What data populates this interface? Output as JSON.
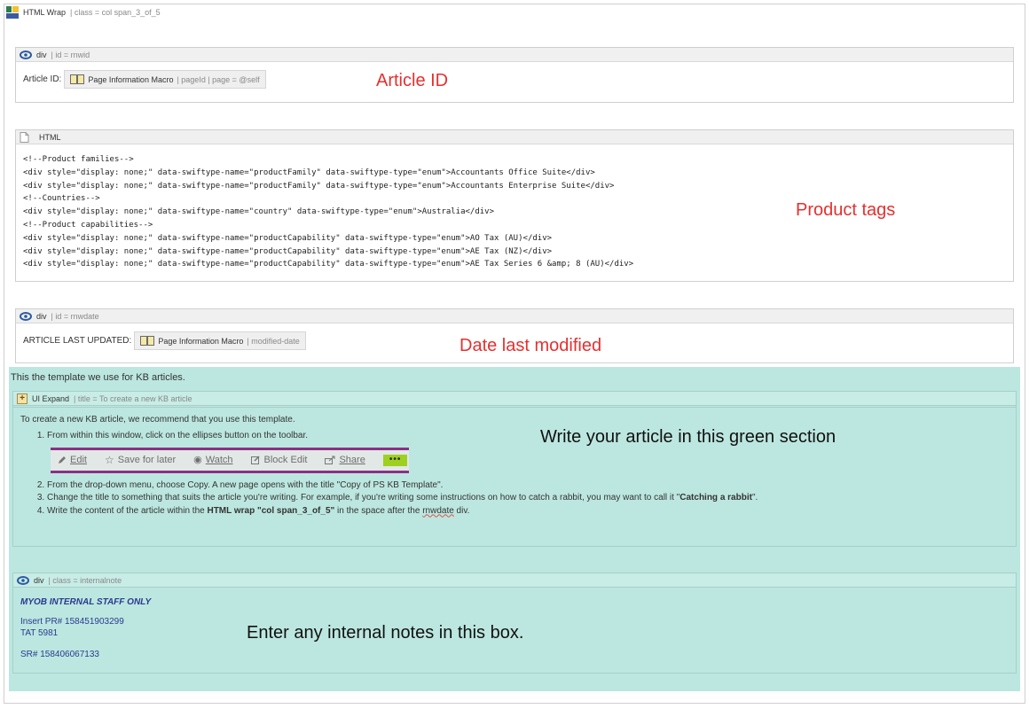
{
  "html_wrap": {
    "title": "HTML Wrap",
    "meta": "| class = col span_3_of_5"
  },
  "article_id_macro": {
    "header_title": "div",
    "header_meta": "| id = rnwid",
    "label": "Article ID:",
    "page_macro_title": "Page Information Macro",
    "page_macro_meta": "| pageId | page = @self",
    "annotation": "Article ID"
  },
  "html_macro": {
    "header_title": "HTML",
    "code_lines": [
      "<!--Product families-->",
      "<div style=\"display: none;\" data-swiftype-name=\"productFamily\" data-swiftype-type=\"enum\">Accountants Office Suite</div>",
      "<div style=\"display: none;\" data-swiftype-name=\"productFamily\" data-swiftype-type=\"enum\">Accountants Enterprise Suite</div>",
      "<!--Countries-->",
      "<div style=\"display: none;\" data-swiftype-name=\"country\" data-swiftype-type=\"enum\">Australia</div>",
      "<!--Product capabilities-->",
      "<div style=\"display: none;\" data-swiftype-name=\"productCapability\" data-swiftype-type=\"enum\">AO Tax (AU)</div>",
      "<div style=\"display: none;\" data-swiftype-name=\"productCapability\" data-swiftype-type=\"enum\">AE Tax (NZ)</div>",
      "<div style=\"display: none;\" data-swiftype-name=\"productCapability\" data-swiftype-type=\"enum\">AE Tax Series 6 &amp; 8 (AU)</div>"
    ],
    "annotation": "Product tags"
  },
  "date_macro": {
    "header_title": "div",
    "header_meta": "| id = rnwdate",
    "label": "ARTICLE LAST UPDATED:",
    "page_macro_title": "Page Information Macro",
    "page_macro_meta": "| modified-date",
    "annotation": "Date last modified"
  },
  "green_section": {
    "intro": "This the template we use for KB articles.",
    "expand_title": "UI Expand",
    "expand_meta": "| title = To create a new KB article",
    "lead": "To create a new KB article, we recommend that you use this template.",
    "step1": "From within this window, click on the ellipses button on the toolbar.",
    "step2": "From the drop-down menu, choose Copy. A new page opens with the title \"Copy of PS KB Template\".",
    "step3_pre": "Change the title to something that suits the article you're writing. For example, if you're writing some instructions on how to catch a rabbit, you may want to call it \"",
    "step3_bold": "Catching a rabbit",
    "step3_post": "\".",
    "step4_pre": "Write the content of the article within the ",
    "step4_bold": "HTML wrap \"col span_3_of_5\"",
    "step4_mid": " in the space after the ",
    "step4_link": "rnwdate",
    "step4_post": " div.",
    "toolbar": {
      "edit": "Edit",
      "save_for_later": "Save for later",
      "watch": "Watch",
      "block_edit": "Block Edit",
      "share": "Share",
      "more": "•••"
    },
    "annotation": "Write your article in this green section"
  },
  "internal_note": {
    "header_title": "div",
    "header_meta": "| class = internalnote",
    "title": "MYOB INTERNAL STAFF ONLY",
    "line1": "Insert PR# 158451903299",
    "line2": "TAT 5981",
    "line3": "SR# 158406067133",
    "annotation": "Enter any internal notes in this box."
  },
  "colors": {
    "green_bg": "#bce7e0",
    "annotation_red": "#e53030",
    "toolbar_border": "#8b2f86",
    "more_button": "#9ed11f",
    "note_text": "#2a3b8f"
  }
}
